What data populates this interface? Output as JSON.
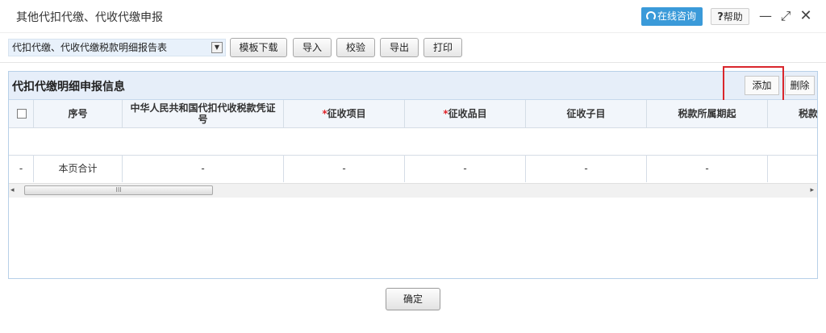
{
  "window": {
    "title": "其他代扣代缴、代收代缴申报",
    "online_consult": "在线咨询",
    "help": "帮助",
    "help_mark": "?",
    "minimize": "—",
    "maximize": "⤢",
    "close": "✕"
  },
  "toolbar": {
    "report_select": "代扣代缴、代收代缴税款明细报告表",
    "template_download": "模板下载",
    "import": "导入",
    "verify": "校验",
    "export": "导出",
    "print": "打印"
  },
  "panel": {
    "title": "代扣代缴明细申报信息",
    "add": "添加",
    "delete": "删除"
  },
  "table": {
    "columns": {
      "seq": "序号",
      "certificate": "中华人民共和国代扣代收税款凭证号",
      "levy_item": "征收项目",
      "levy_category": "征收品目",
      "levy_subitem": "征收子目",
      "period_start": "税款所属期起",
      "next_partial": "税款"
    },
    "required_mark": "*",
    "total_row": {
      "check": "-",
      "seq": "本页合计",
      "certificate": "-",
      "levy_item": "-",
      "levy_category": "-",
      "levy_subitem": "-",
      "period_start": "-"
    }
  },
  "scrollbar": {
    "left_arrow": "◂",
    "right_arrow": "▸",
    "grip": "III"
  },
  "footer": {
    "confirm": "确定"
  },
  "colors": {
    "accent": "#3a9ad9",
    "panel_header": "#e6eef9",
    "highlight_border": "#d9262c",
    "required": "#e0242a"
  }
}
